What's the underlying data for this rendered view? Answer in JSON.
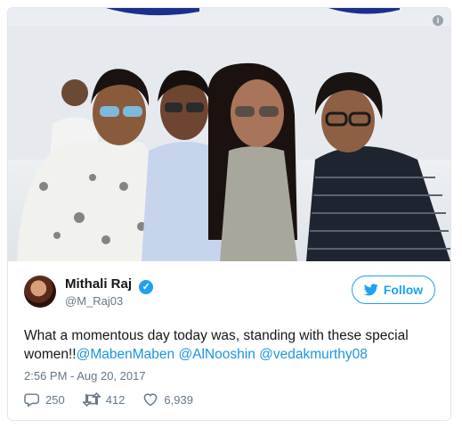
{
  "tweet": {
    "author_name": "Mithali Raj",
    "author_handle": "@M_Raj03",
    "follow_label": "Follow",
    "text_prefix": "What a momentous day today was, standing with these special women!!",
    "mentions": [
      "@MabenMaben",
      "@AlNooshin",
      "@vedakmurthy08"
    ],
    "timestamp": "2:56 PM - Aug 20, 2017",
    "replies": "250",
    "retweets": "412",
    "likes": "6,939"
  },
  "icons": {
    "info": "info-icon",
    "verified": "verified-badge-icon",
    "twitter": "twitter-bird-icon",
    "reply": "reply-icon",
    "retweet": "retweet-icon",
    "like": "heart-icon"
  },
  "colors": {
    "accent": "#1da1f2",
    "mention": "#1b95e0",
    "muted": "#657786",
    "text": "#14171a"
  }
}
